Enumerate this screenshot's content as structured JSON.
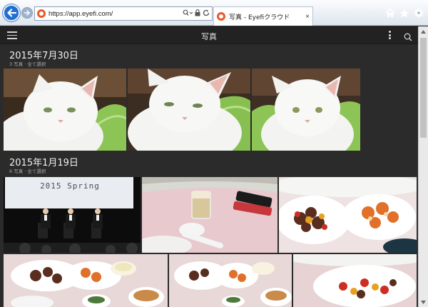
{
  "browser": {
    "url": "https://app.eyefi.com/",
    "tab_title": "写真 - Eyefiクラウド",
    "tab_close": "×"
  },
  "header": {
    "title": "写真"
  },
  "groups": [
    {
      "date": "2015年7月30日",
      "subtitle": "3 写真 · 全て選択"
    },
    {
      "date": "2015年1月19日",
      "subtitle": "6 写真 · 全て選択"
    }
  ],
  "photos": {
    "slide_text": "2015 Spring"
  },
  "colors": {
    "app_background": "#2b2b2b",
    "header_background": "#222222",
    "brand_orange": "#e85a28",
    "ie_back_blue": "#1f6fd1"
  },
  "icons": [
    "back-arrow-icon",
    "forward-arrow-icon",
    "search-icon",
    "refresh-icon",
    "lock-icon",
    "home-icon",
    "star-icon",
    "gear-icon",
    "hamburger-icon",
    "more-vertical-icon"
  ]
}
